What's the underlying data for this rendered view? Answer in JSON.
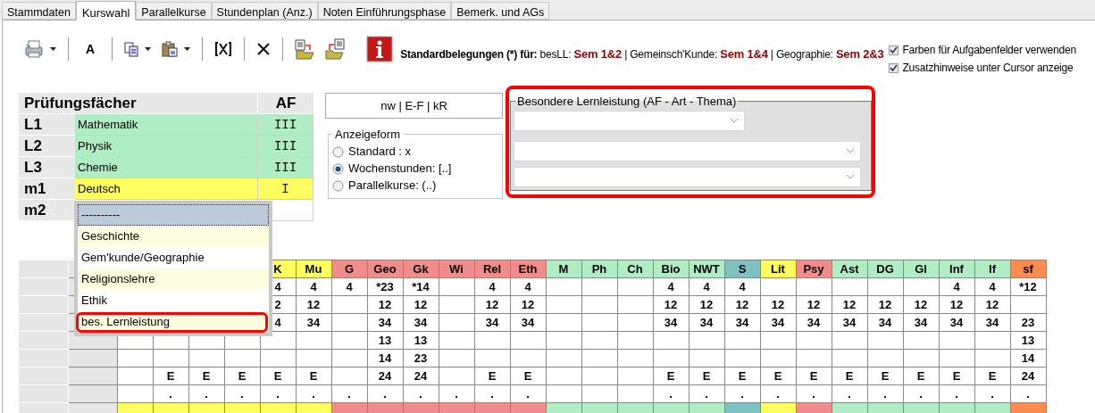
{
  "tabs": [
    {
      "label": "Stammdaten",
      "selected": false
    },
    {
      "label": "Kurswahl",
      "selected": true
    },
    {
      "label": "Parallelkurse",
      "selected": false
    },
    {
      "label": "Stundenplan (Anz.)",
      "selected": false
    },
    {
      "label": "Noten Einführungsphase",
      "selected": false
    },
    {
      "label": "Bemerk. und AGs",
      "selected": false
    }
  ],
  "toolbar": [
    {
      "kind": "printer",
      "dropdown": true
    },
    {
      "kind": "separator"
    },
    {
      "kind": "font",
      "label": "A"
    },
    {
      "kind": "separator"
    },
    {
      "kind": "copy",
      "dropdown": true
    },
    {
      "kind": "paste",
      "dropdown": true
    },
    {
      "kind": "separator"
    },
    {
      "kind": "bracket-x"
    },
    {
      "kind": "separator"
    },
    {
      "kind": "close"
    },
    {
      "kind": "separator"
    },
    {
      "kind": "import"
    },
    {
      "kind": "export"
    },
    {
      "kind": "info"
    }
  ],
  "defaults": {
    "title": "Standardbelegungen (*) für:",
    "entries": [
      {
        "label": "besLL:",
        "value": "Sem 1&2"
      },
      {
        "label": "| Gemeinsch'Kunde:",
        "value": "Sem 1&4"
      },
      {
        "label": "| Geographie:",
        "value": "Sem 2&3"
      }
    ]
  },
  "options": [
    {
      "label": "Farben für Aufgabenfelder verwenden",
      "checked": true
    },
    {
      "label": "Zusatzhinweise unter Cursor anzeige",
      "checked": true
    }
  ],
  "exam_subjects": {
    "title": "Prüfungsfächer",
    "af_title": "AF",
    "rows": [
      {
        "slot": "L1",
        "subject": "Mathematik",
        "af": "III",
        "color": "#b0ecc4"
      },
      {
        "slot": "L2",
        "subject": "Physik",
        "af": "III",
        "color": "#b0ecc4"
      },
      {
        "slot": "L3",
        "subject": "Chemie",
        "af": "III",
        "color": "#b0ecc4"
      },
      {
        "slot": "m1",
        "subject": "Deutsch",
        "af": "I",
        "color": "#ffff60"
      },
      {
        "slot": "m2"
      }
    ]
  },
  "dropdown": {
    "items": [
      {
        "label": "----------",
        "selected": true,
        "highlighted": false
      },
      {
        "label": "Geschichte",
        "selected": false,
        "highlighted": false
      },
      {
        "label": "Gem'kunde/Geographie",
        "selected": false,
        "highlighted": false
      },
      {
        "label": "Religionslehre",
        "selected": false,
        "highlighted": false
      },
      {
        "label": "Ethik",
        "selected": false,
        "highlighted": false
      },
      {
        "label": "bes. Lernleistung",
        "selected": false,
        "highlighted": true
      }
    ]
  },
  "summary_box": "nw | E-F | kR",
  "display_form": {
    "title": "Anzeigeform",
    "options": [
      {
        "label": "Standard : x",
        "selected": false
      },
      {
        "label": "Wochenstunden: [..]",
        "selected": true
      },
      {
        "label": "Parallelkurse: (..)",
        "selected": false
      }
    ]
  },
  "special_performance": {
    "title": "Besondere Lernleistung (AF - Art - Thema)",
    "highlighted": true,
    "selects": [
      {
        "kind": "short"
      },
      {
        "kind": "wide"
      },
      {
        "kind": "wide"
      }
    ]
  },
  "grid": {
    "columns": [
      {
        "color": "#ffff60"
      },
      {
        "color": "#ffff60"
      },
      {
        "color": "#ffff60"
      },
      {
        "color": "#ffff60"
      },
      {
        "color": "#ffff60"
      },
      {
        "color": "#ffff60"
      },
      {
        "color": "#f08c8c"
      },
      {
        "color": "#f08c8c"
      },
      {
        "color": "#f08c8c"
      },
      {
        "color": "#f08c8c"
      },
      {
        "color": "#f08c8c"
      },
      {
        "color": "#f08c8c"
      },
      {
        "color": "#b0ecc4"
      },
      {
        "color": "#b0ecc4"
      },
      {
        "color": "#b0ecc4"
      },
      {
        "color": "#b0ecc4"
      },
      {
        "color": "#b0ecc4"
      },
      {
        "color": "#80c0c0"
      },
      {
        "color": "#ffff60"
      },
      {
        "color": "#f08c8c"
      },
      {
        "color": "#b0ecc4"
      },
      {
        "color": "#b0ecc4"
      },
      {
        "color": "#b0ecc4"
      },
      {
        "color": "#b0ecc4"
      },
      {
        "color": "#b0ecc4"
      },
      {
        "color": "#fa8c50"
      }
    ],
    "header_top": [
      "K",
      "Mu",
      "G",
      "Geo",
      "Gk",
      "Wi",
      "Rel",
      "Eth",
      "M",
      "Ph",
      "Ch",
      "Bio",
      "NWT",
      "S",
      "Lit",
      "Psy",
      "Ast",
      "DG",
      "Gl",
      "Inf",
      "If",
      "sf"
    ],
    "rows": [
      [
        null,
        null,
        null,
        null,
        "4",
        "4",
        "4",
        "*23",
        "*14",
        null,
        "4",
        "4",
        null,
        null,
        null,
        "4",
        "4",
        "4",
        null,
        null,
        null,
        null,
        null,
        "4",
        "4",
        "*12"
      ],
      [
        null,
        null,
        null,
        null,
        "2",
        "12",
        null,
        "12",
        "12",
        null,
        "12",
        "12",
        null,
        null,
        null,
        "12",
        "12",
        "12",
        "12",
        "12",
        "12",
        "12",
        "12",
        "12",
        "12",
        null
      ],
      [
        null,
        null,
        null,
        null,
        "4",
        "34",
        null,
        "34",
        "34",
        null,
        "34",
        "34",
        null,
        null,
        null,
        "34",
        "34",
        "34",
        "34",
        "34",
        "34",
        "34",
        "34",
        "34",
        "34",
        "23"
      ],
      [
        null,
        null,
        null,
        null,
        null,
        null,
        null,
        "13",
        "13",
        null,
        null,
        null,
        null,
        null,
        null,
        null,
        null,
        null,
        null,
        null,
        null,
        null,
        null,
        null,
        null,
        "13"
      ],
      [
        null,
        null,
        null,
        null,
        null,
        null,
        null,
        "14",
        "23",
        null,
        null,
        null,
        null,
        null,
        null,
        null,
        null,
        null,
        null,
        null,
        null,
        null,
        null,
        null,
        null,
        "14"
      ],
      [
        null,
        "E",
        "E",
        "E",
        "E",
        "E",
        null,
        "24",
        "24",
        null,
        "E",
        "E",
        null,
        null,
        null,
        "E",
        "E",
        "E",
        "E",
        "E",
        "E",
        "E",
        "E",
        "E",
        "E",
        "24"
      ],
      [
        null,
        ".",
        ".",
        ".",
        ".",
        ".",
        ".",
        ".",
        ".",
        ".",
        ".",
        ".",
        null,
        null,
        null,
        ".",
        ".",
        ".",
        ".",
        ".",
        ".",
        ".",
        ".",
        ".",
        ".",
        "."
      ]
    ]
  }
}
